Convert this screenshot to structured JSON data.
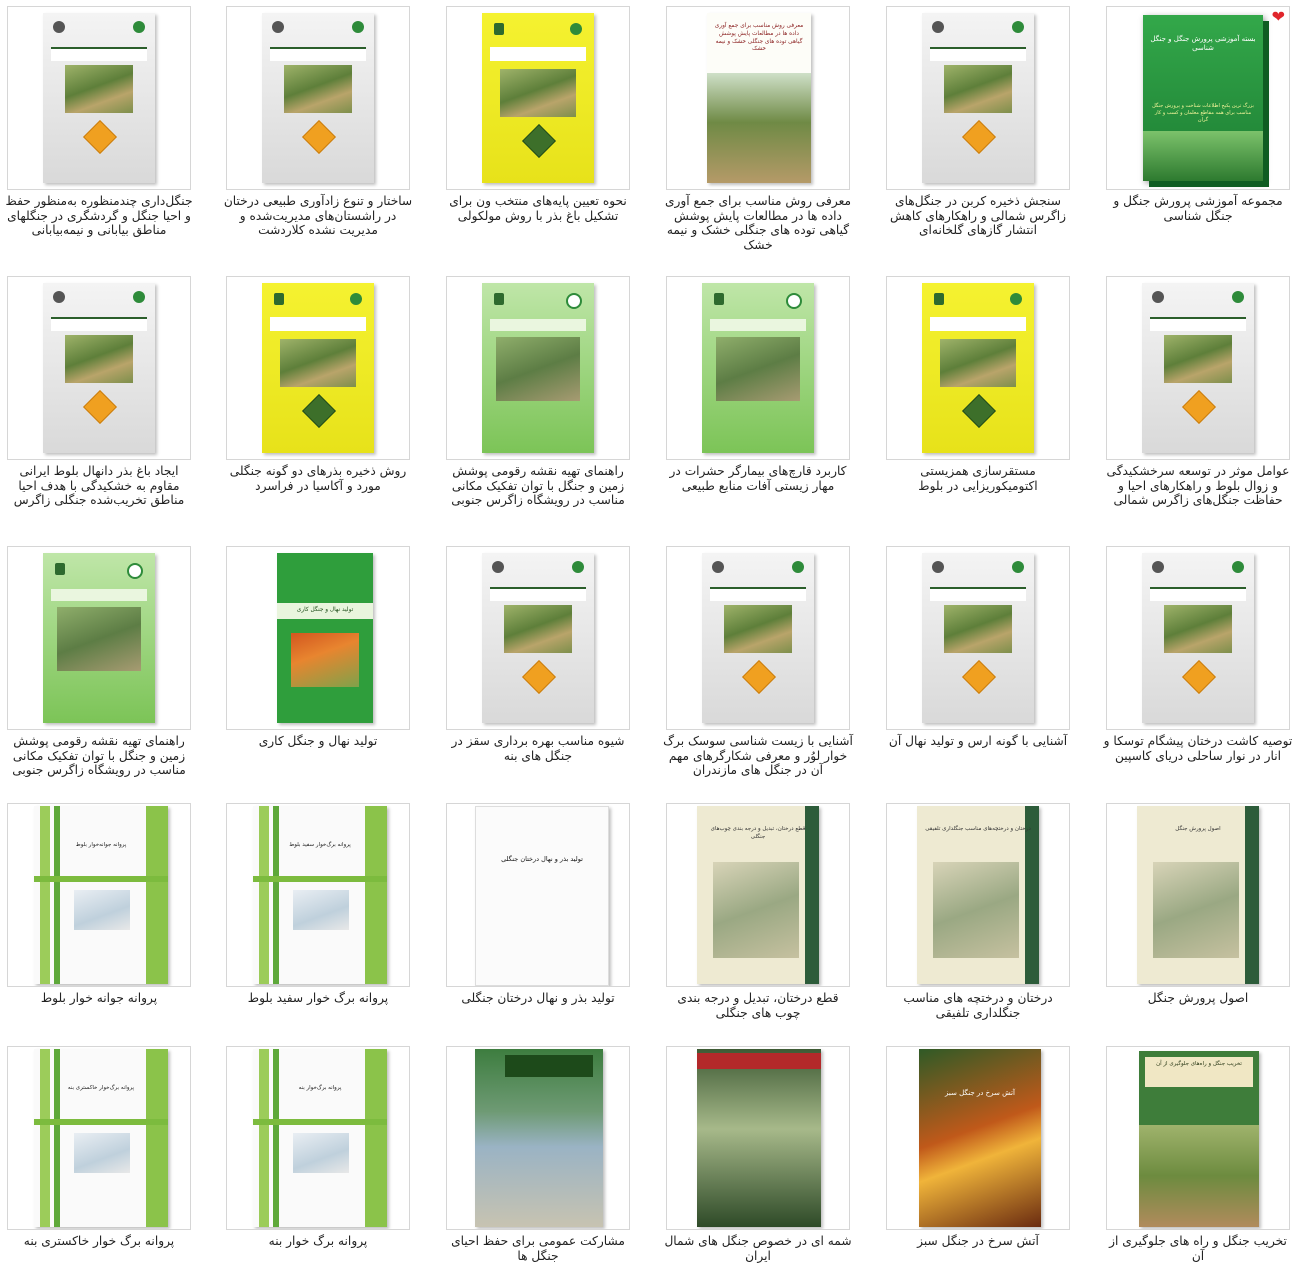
{
  "favorite_icon": "heart-icon",
  "colors": {
    "favorite": "#e0262c",
    "border": "#d6d6d6",
    "caption": "#222222"
  },
  "rows": [
    [
      {
        "caption": "مجموعه آموزشی پرورش جنگل و جنگل شناسی",
        "cover": {
          "style": "green3d",
          "title": "بسته آموزشی پرورش جنگل و جنگل شناسی",
          "subtitle": "بزرگ ترین پکیج اطلاعات شناخت و پرورش جنگل مناسب برای همه مقاطع معلمان و کسب و کار گران"
        },
        "favorite": true
      },
      {
        "caption": "سنجش ذخیره کربن در جنگل‌های زاگرس شمالی و راهکارهای کاهش انتشار گازهای گلخانه‌ای",
        "cover": {
          "style": "grey"
        }
      },
      {
        "caption": "معرفی روش مناسب برای جمع آوری داده ها در مطالعات پایش پوشش گیاهی توده های جنگلی خشک و نیمه خشک",
        "cover": {
          "style": "white-photo",
          "title": "معرفی روش مناسب برای جمع آوری داده ها در مطالعات پایش پوشش گیاهی توده های جنگلی خشک و نیمه خشک"
        }
      },
      {
        "caption": "نحوه تعیین پایه‌های منتخب ون برای تشکیل باغ بذر با روش مولکولی",
        "cover": {
          "style": "yellow"
        }
      },
      {
        "caption": "ساختار و تنوع زادآوری طبیعی درختان در راشستان‌های مدیریت‌شده و مدیریت نشده کلاردشت",
        "cover": {
          "style": "grey"
        }
      },
      {
        "caption": "جنگل‌داری چندمنظوره به‌منظور حفظ و احیا جنگل و گردشگری در جنگلهای مناطق بیابانی و نیمه‌بیابانی",
        "cover": {
          "style": "grey"
        }
      }
    ],
    [
      {
        "caption": "عوامل موثر در توسعه سرخشکیدگی و زوال بلوط و راهکارهای احیا و حفاظت جنگل‌های زاگرس شمالی",
        "cover": {
          "style": "grey"
        }
      },
      {
        "caption": "مستقرسازی همزیستی اکتومیکوریزایی در بلوط",
        "cover": {
          "style": "yellow"
        }
      },
      {
        "caption": "کاربرد قارچ‌های بیمارگر حشرات در مهار زیستی آفات منابع طبیعی",
        "cover": {
          "style": "green-light"
        }
      },
      {
        "caption": "راهنمای تهیه نقشه رقومی پوشش زمین و جنگل با توان تفکیک مکانی مناسب در رویشگاه زاگرس جنوبی",
        "cover": {
          "style": "green-light"
        }
      },
      {
        "caption": "روش ذخیره بذرهای دو گونه جنگلی مورد و آکاسیا در فراسرد",
        "cover": {
          "style": "yellow"
        }
      },
      {
        "caption": "ایجاد باغ بذر دانهال بلوط ایرانی مقاوم به خشکیدگی با هدف احیا مناطق تخریب‌شده جنگلی زاگرس",
        "cover": {
          "style": "grey"
        }
      }
    ],
    [
      {
        "caption": "توصیه کاشت درختان پیشگام توسکا و انار در نوار ساحلی دریای کاسپین",
        "cover": {
          "style": "grey"
        }
      },
      {
        "caption": "آشنایی با گونه ارس و تولید نهال آن",
        "cover": {
          "style": "grey"
        }
      },
      {
        "caption": "آشنایی با زیست شناسی سوسک برگ خوار لوُر و معرفی شکارگرهای مهم آن در جنگل های مازندران",
        "cover": {
          "style": "grey"
        }
      },
      {
        "caption": "شیوه مناسب بهره برداری سقز در جنگل های بنه",
        "cover": {
          "style": "grey"
        }
      },
      {
        "caption": "تولید نهال و جنگل کاری",
        "cover": {
          "style": "green-solid",
          "title": "تولید نهال و جنگل کاری"
        }
      },
      {
        "caption": "راهنمای تهیه نقشه رقومی پوشش زمین و جنگل با توان تفکیک مکانی مناسب در رویشگاه زاگرس جنوبی",
        "cover": {
          "style": "green-light"
        }
      }
    ],
    [
      {
        "caption": "اصول پرورش جنگل",
        "cover": {
          "style": "old-cream",
          "title": "اصول پرورش جنگل"
        }
      },
      {
        "caption": "درختان و درختچه های مناسب جنگلداری تلفیقی",
        "cover": {
          "style": "old-cream",
          "title": "درختان و درختچه‌های مناسب جنگلداری تلفیقی"
        }
      },
      {
        "caption": "قطع درختان، تبدیل و درجه بندی چوب های جنگلی",
        "cover": {
          "style": "old-cream",
          "title": "قطع درختان، تبدیل و درجه بندی چوب‌های جنگلی"
        }
      },
      {
        "caption": "تولید بذر و نهال درختان جنگلی",
        "cover": {
          "style": "plain-white",
          "title": "تولید بذر و نهال درختان جنگلی"
        }
      },
      {
        "caption": "پروانه برگ خوار سفید بلوط",
        "cover": {
          "style": "green-stripe",
          "title": "پروانه برگ‌خوار سفید بلوط"
        }
      },
      {
        "caption": "پروانه جوانه خوار بلوط",
        "cover": {
          "style": "green-stripe",
          "title": "پروانه جوانه‌خوار بلوط"
        }
      }
    ],
    [
      {
        "caption": "تخریب جنگل و راه های جلوگیری از آن",
        "cover": {
          "style": "old-green",
          "title": "تخریب جنگل و راه‌های جلوگیری از آن"
        }
      },
      {
        "caption": "آتش سرخ در جنگل سبز",
        "cover": {
          "style": "fire",
          "title": "آتش سرخ در جنگل سبز"
        }
      },
      {
        "caption": "شمه ای در خصوص جنگل های شمال ایران",
        "cover": {
          "style": "forest-dark"
        }
      },
      {
        "caption": "مشارکت عمومی برای حفظ احیای جنگل ها",
        "cover": {
          "style": "poster"
        }
      },
      {
        "caption": "پروانه برگ خوار بنه",
        "cover": {
          "style": "green-stripe",
          "title": "پروانه برگ‌خوار بنه"
        }
      },
      {
        "caption": "پروانه برگ خوار خاکستری بنه",
        "cover": {
          "style": "green-stripe",
          "title": "پروانه برگ‌خوار خاکستری بنه"
        }
      }
    ]
  ]
}
